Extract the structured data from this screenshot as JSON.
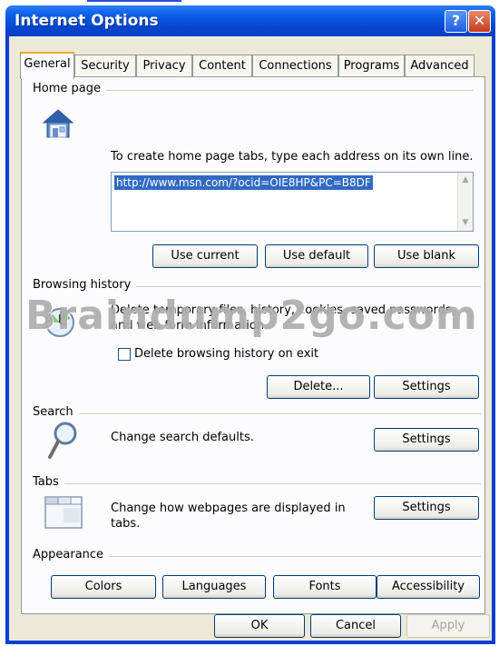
{
  "window": {
    "title": "Internet Options",
    "help_glyph": "?",
    "close_glyph": "✕"
  },
  "tabs": [
    {
      "label": "General",
      "active": true
    },
    {
      "label": "Security"
    },
    {
      "label": "Privacy"
    },
    {
      "label": "Content"
    },
    {
      "label": "Connections"
    },
    {
      "label": "Programs"
    },
    {
      "label": "Advanced"
    }
  ],
  "home_page": {
    "group_label": "Home page",
    "icon": "house-icon",
    "instruction": "To create home page tabs, type each address on its own line.",
    "url_value": "http://www.msn.com/?ocid=OIE8HP&PC=B8DF",
    "buttons": [
      "Use current",
      "Use default",
      "Use blank"
    ]
  },
  "browsing_history": {
    "group_label": "Browsing history",
    "icon": "history-clock-icon",
    "description_line1": "Delete temporary files, history, cookies, saved passwords,",
    "description_line2": "and web form information.",
    "checkbox_label": "Delete browsing history on exit",
    "buttons": [
      "Delete...",
      "Settings"
    ]
  },
  "search": {
    "group_label": "Search",
    "icon": "magnifier-icon",
    "description": "Change search defaults.",
    "button": "Settings"
  },
  "tabs_section": {
    "group_label": "Tabs",
    "icon": "tabbed-window-icon",
    "description_line1": "Change how webpages are displayed in",
    "description_line2": "tabs.",
    "button": "Settings"
  },
  "appearance": {
    "group_label": "Appearance",
    "buttons": [
      "Colors",
      "Languages",
      "Fonts",
      "Accessibility"
    ]
  },
  "footer": {
    "ok": "OK",
    "cancel": "Cancel",
    "apply": "Apply"
  },
  "watermark": "Braindump2go.com",
  "colors": {
    "titlebar": "#0a5fe8",
    "dialog_bg": "#ece9d8",
    "active_tab_accent": "#f5a623",
    "selection": "#316ac5"
  }
}
